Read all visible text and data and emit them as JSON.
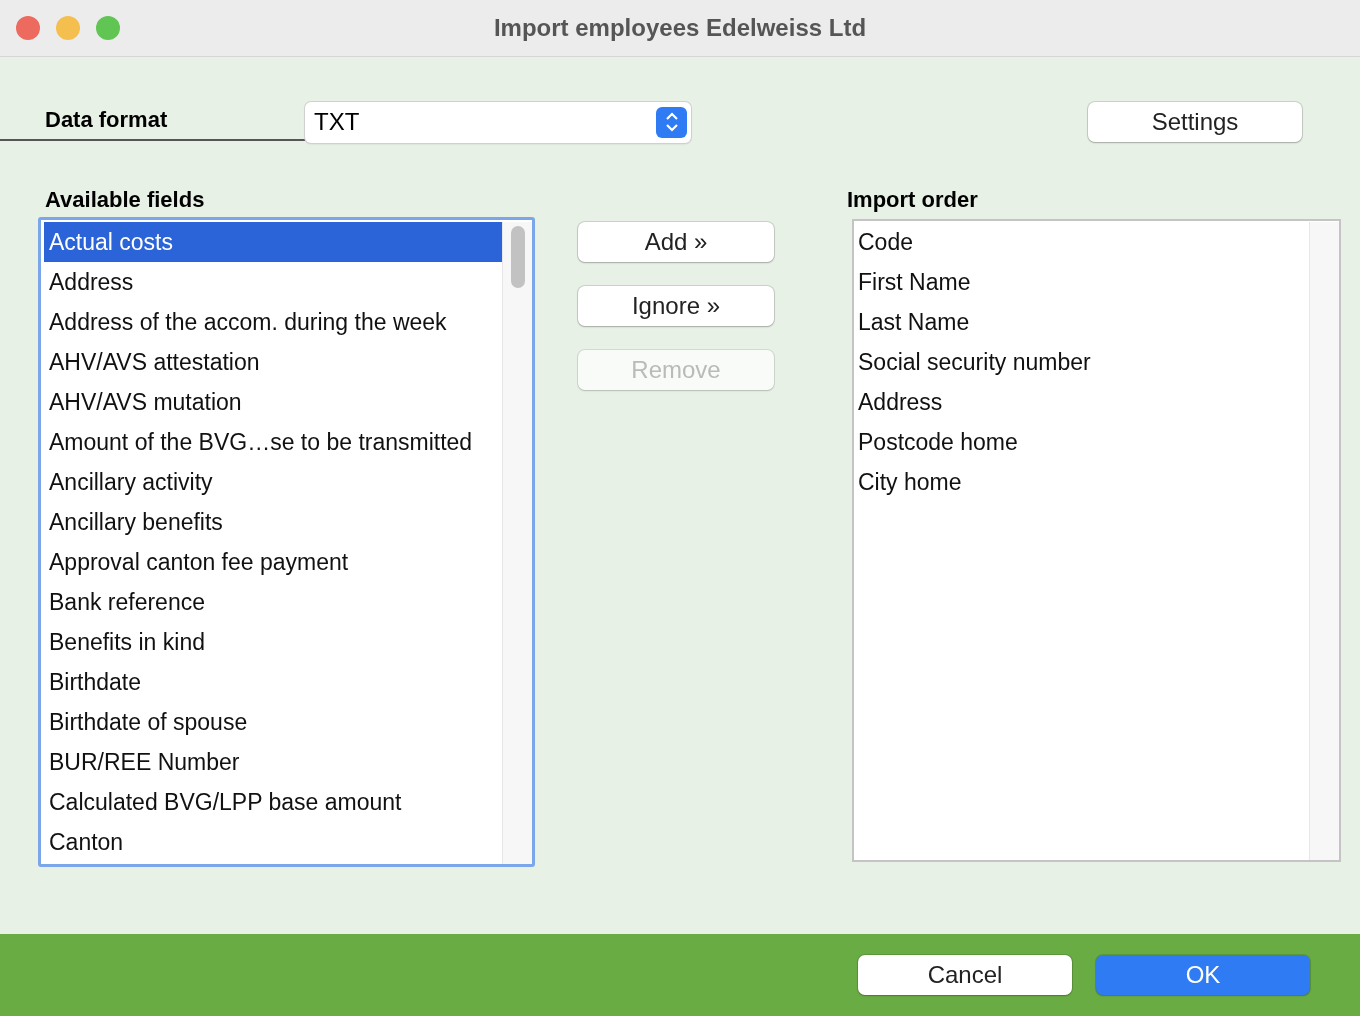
{
  "window": {
    "title": "Import employees Edelweiss Ltd"
  },
  "data_format": {
    "label": "Data format",
    "value": "TXT"
  },
  "settings_button": "Settings",
  "available_fields": {
    "label": "Available fields",
    "items": [
      {
        "label": "Actual costs",
        "selected": true
      },
      {
        "label": "Address",
        "selected": false
      },
      {
        "label": "Address of the accom. during the week",
        "selected": false
      },
      {
        "label": "AHV/AVS attestation",
        "selected": false
      },
      {
        "label": "AHV/AVS mutation",
        "selected": false
      },
      {
        "label": "Amount of the BVG…se to be transmitted",
        "selected": false
      },
      {
        "label": "Ancillary activity",
        "selected": false
      },
      {
        "label": "Ancillary benefits",
        "selected": false
      },
      {
        "label": "Approval canton fee payment",
        "selected": false
      },
      {
        "label": "Bank reference",
        "selected": false
      },
      {
        "label": "Benefits in kind",
        "selected": false
      },
      {
        "label": "Birthdate",
        "selected": false
      },
      {
        "label": "Birthdate of spouse",
        "selected": false
      },
      {
        "label": "BUR/REE Number",
        "selected": false
      },
      {
        "label": "Calculated BVG/LPP base amount",
        "selected": false
      },
      {
        "label": "Canton",
        "selected": false
      }
    ]
  },
  "actions": [
    {
      "label": "Add »",
      "disabled": false
    },
    {
      "label": "Ignore »",
      "disabled": false
    },
    {
      "label": "Remove",
      "disabled": true
    }
  ],
  "import_order": {
    "label": "Import order",
    "items": [
      "Code",
      "First Name",
      "Last Name",
      "Social security number",
      "Address",
      "Postcode home",
      "City home"
    ]
  },
  "footer": {
    "cancel": "Cancel",
    "ok": "OK"
  }
}
